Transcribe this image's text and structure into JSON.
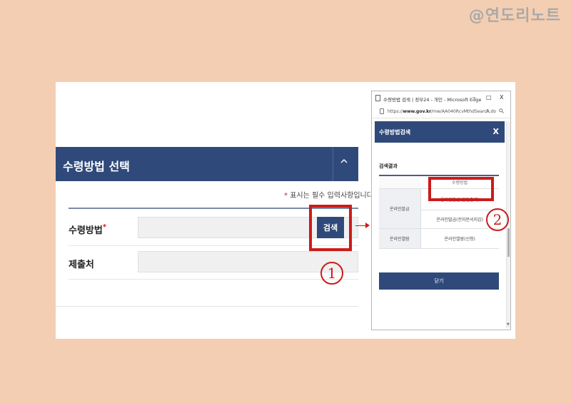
{
  "watermark": "@연도리노트",
  "form": {
    "title": "수령방법 선택",
    "toggle_icon": "chevron-up-icon",
    "required_note": "표시는 필수 입력사항입니다.",
    "rows": [
      {
        "label": "수령방법",
        "required": true
      },
      {
        "label": "제출처",
        "required": false
      }
    ],
    "search_button": "검색"
  },
  "annotations": {
    "step1": "1",
    "step2": "2"
  },
  "popup": {
    "window_title": "수령방법 검색 | 정부24 - 개인 - Microsoft Edge",
    "controls": [
      "–",
      "□",
      "X"
    ],
    "url_prefix": "https://",
    "url_host": "www.gov.kr",
    "url_path": "/mw/AA040RcvMthdSearch.do",
    "reader_label": "A",
    "header_title": "수령방법검색",
    "close_icon_label": "X",
    "section_title": "검색결과",
    "table": {
      "column_header": "수령방법",
      "groups": [
        {
          "category": "온라인발급",
          "options": [
            "온라인발급(본인출력)",
            "온라인발급(전자문서지갑)"
          ]
        },
        {
          "category": "온라인열람",
          "options": [
            "온라인열람(신청)"
          ]
        }
      ]
    },
    "close_button": "닫기"
  },
  "colors": {
    "header_navy": "#2f4a7a",
    "highlight_red": "#cc1b1b",
    "background_peach": "#f4ceb2"
  }
}
